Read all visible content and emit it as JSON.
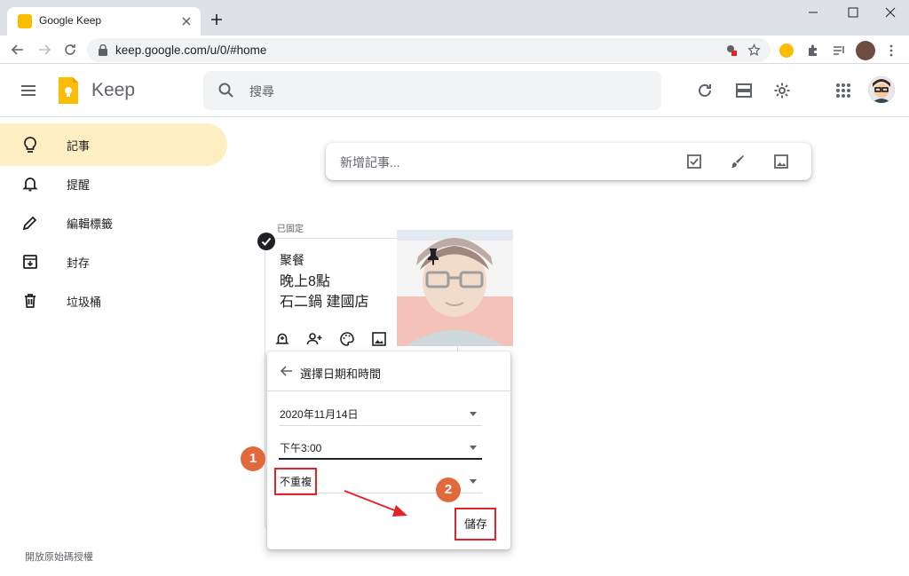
{
  "browser": {
    "tab_title": "Google Keep",
    "url": "keep.google.com/u/0/#home"
  },
  "header": {
    "app_name": "Keep",
    "search_placeholder": "搜尋"
  },
  "sidebar": {
    "items": [
      {
        "label": "記事",
        "icon": "lightbulb-icon",
        "active": true
      },
      {
        "label": "提醒",
        "icon": "bell-icon",
        "active": false
      },
      {
        "label": "編輯標籤",
        "icon": "pencil-icon",
        "active": false
      },
      {
        "label": "封存",
        "icon": "archive-icon",
        "active": false
      },
      {
        "label": "垃圾桶",
        "icon": "trash-icon",
        "active": false
      }
    ],
    "license_link": "開放原始碼授權"
  },
  "take_note": {
    "placeholder": "新增記事..."
  },
  "notes": {
    "pinned_label": "已固定",
    "note": {
      "title": "聚餐",
      "body": "晚上8點\n石二鍋 建國店"
    }
  },
  "reminder_popup": {
    "title": "選擇日期和時間",
    "date": "2020年11月14日",
    "time": "下午3:00",
    "repeat": "不重複",
    "save_label": "儲存"
  },
  "annotations": {
    "step1": "1",
    "step2": "2",
    "color": "#e0242a",
    "badge_color": "#e06a3c"
  },
  "colors": {
    "active_nav_bg": "#feefc3",
    "keep_yellow": "#fbbc04"
  }
}
